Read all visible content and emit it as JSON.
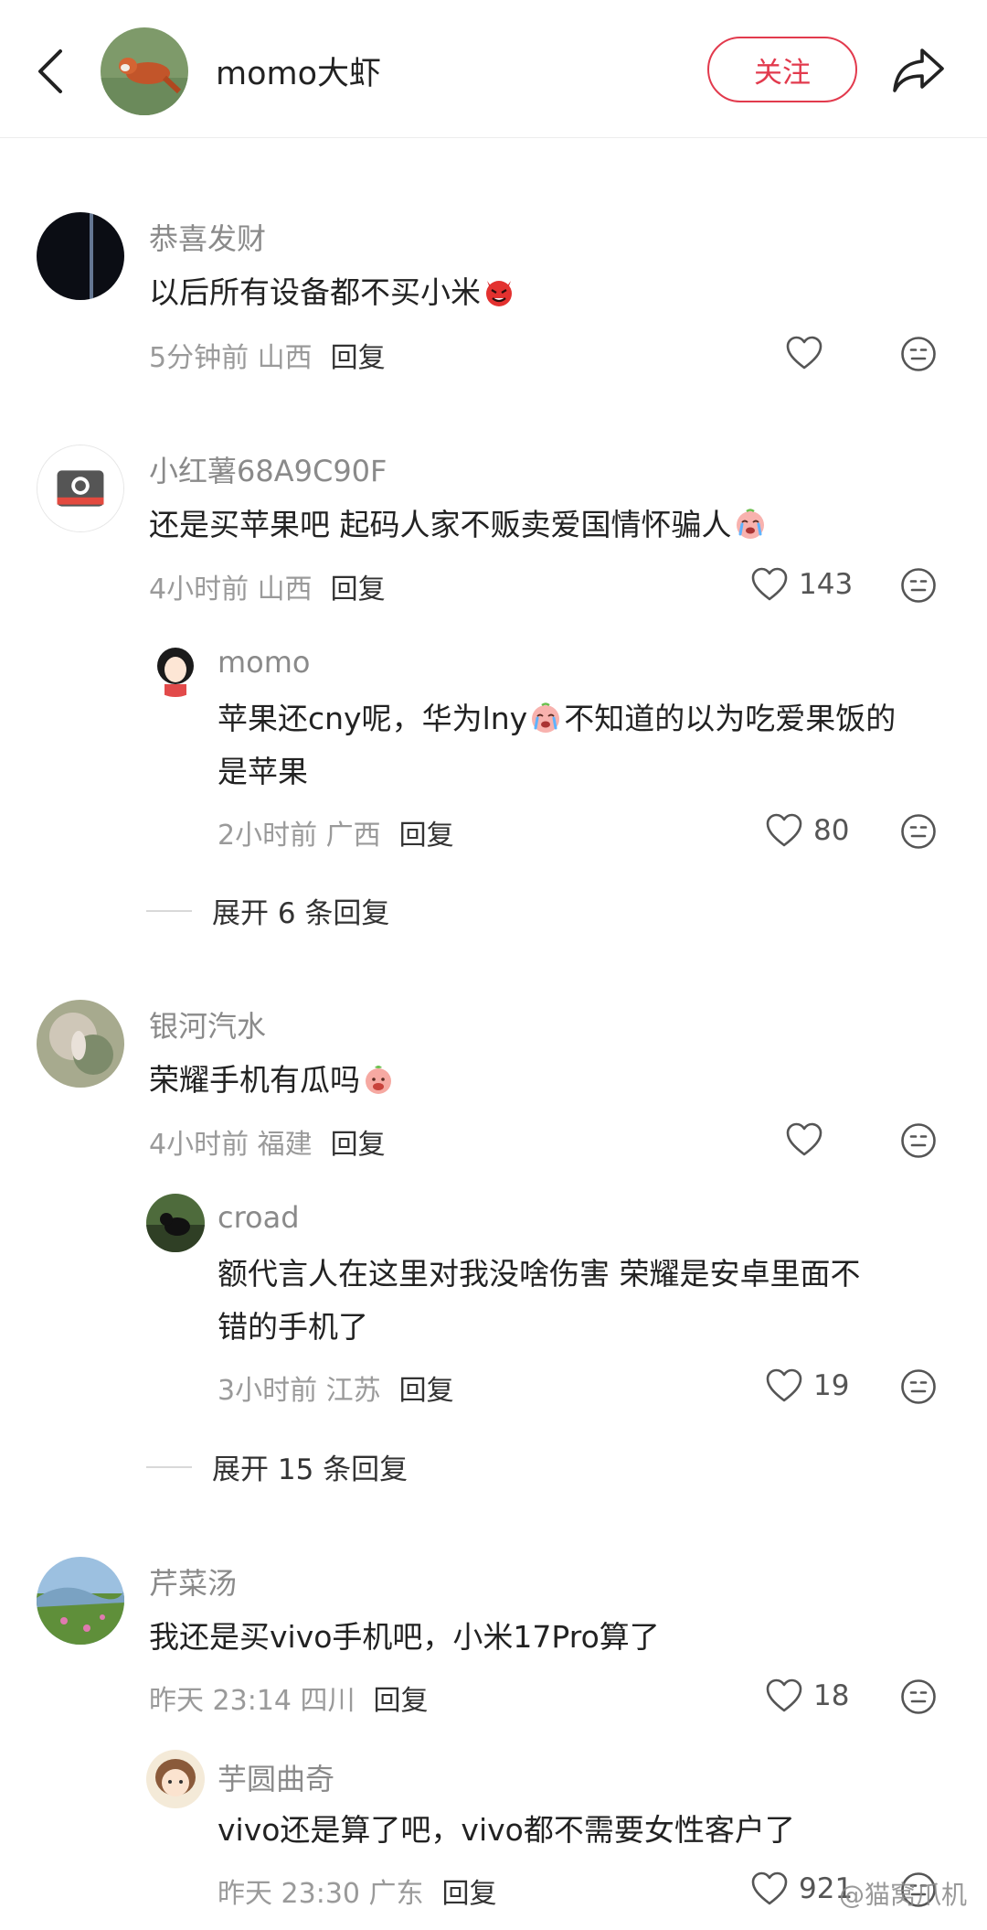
{
  "header": {
    "author_name": "momo大虾",
    "follow_label": "关注"
  },
  "comments": [
    {
      "user": "恭喜发财",
      "text_parts": [
        "以后所有设备都不买小米"
      ],
      "emoji": "devil-emoji",
      "time": "5分钟前 山西",
      "reply_label": "回复",
      "likes": ""
    },
    {
      "user": "小红薯68A9C90F",
      "text_parts": [
        "还是买苹果吧  起码人家不贩卖爱国情怀骗人"
      ],
      "emoji": "crying-emoji",
      "time": "4小时前 山西",
      "reply_label": "回复",
      "likes": "143",
      "replies": [
        {
          "user": "momo",
          "text_line1_a": "苹果还cny呢，华为lny",
          "text_line1_b": "不知道的以为吃爱果饭的",
          "text_line2": "是苹果",
          "emoji": "crying-emoji",
          "time": "2小时前 广西",
          "reply_label": "回复",
          "likes": "80"
        }
      ],
      "expand_label": "展开 6 条回复"
    },
    {
      "user": "银河汽水",
      "text_parts": [
        "荣耀手机有瓜吗"
      ],
      "emoji": "peach-emoji",
      "time": "4小时前 福建",
      "reply_label": "回复",
      "likes": "",
      "replies": [
        {
          "user": "croad",
          "text_line1": "额代言人在这里对我没啥伤害 荣耀是安卓里面不",
          "text_line2": "错的手机了",
          "time": "3小时前 江苏",
          "reply_label": "回复",
          "likes": "19"
        }
      ],
      "expand_label": "展开 15 条回复"
    },
    {
      "user": "芹菜汤",
      "text_parts": [
        "我还是买vivo手机吧，小米17Pro算了"
      ],
      "time": "昨天 23:14 四川",
      "reply_label": "回复",
      "likes": "18",
      "replies": [
        {
          "user": "芋圆曲奇",
          "text_line1": "vivo还是算了吧，vivo都不需要女性客户了",
          "time": "昨天 23:30 广东",
          "reply_label": "回复",
          "likes": "921"
        }
      ]
    }
  ],
  "watermark": "@猫窝爪机",
  "colors": {
    "accent": "#e23a4d",
    "muted": "#9a9a9a"
  },
  "icons": [
    "back-icon",
    "share-icon",
    "heart-icon",
    "emoji-face-icon"
  ]
}
